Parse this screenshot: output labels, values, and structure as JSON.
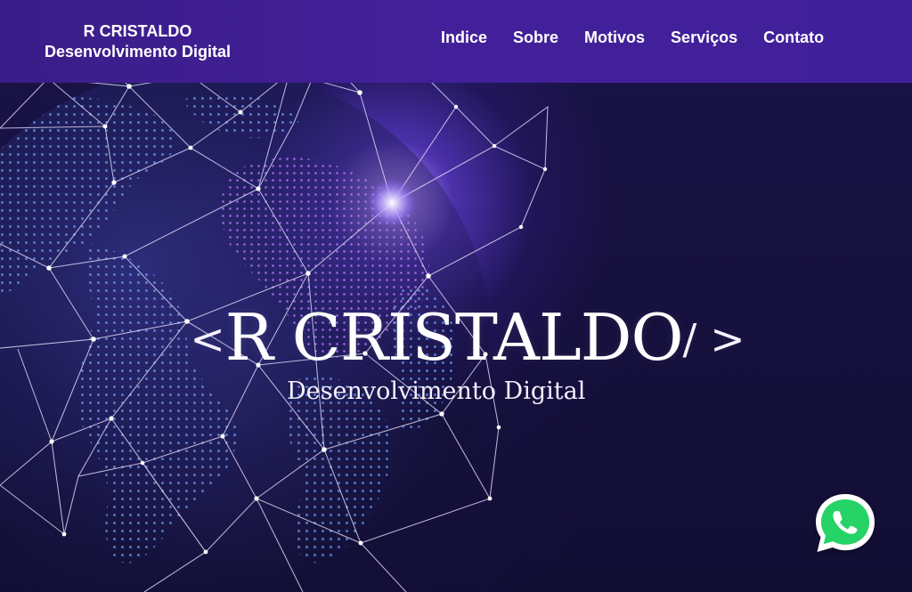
{
  "brand": {
    "name": "R CRISTALDO",
    "tagline": "Desenvolvimento Digital"
  },
  "nav": {
    "items": [
      {
        "label": "Indice"
      },
      {
        "label": "Sobre"
      },
      {
        "label": "Motivos"
      },
      {
        "label": "Serviços"
      },
      {
        "label": "Contato"
      }
    ]
  },
  "hero": {
    "open_mark": "<",
    "title": "R CRISTALDO",
    "close_mark": "/ >",
    "subtitle": "Desenvolvimento Digital"
  },
  "colors": {
    "header": "#43209a",
    "background": "#140f3a",
    "glow": "#7c59ff",
    "whatsapp": "#25d366"
  },
  "icons": {
    "whatsapp": "whatsapp-icon"
  }
}
